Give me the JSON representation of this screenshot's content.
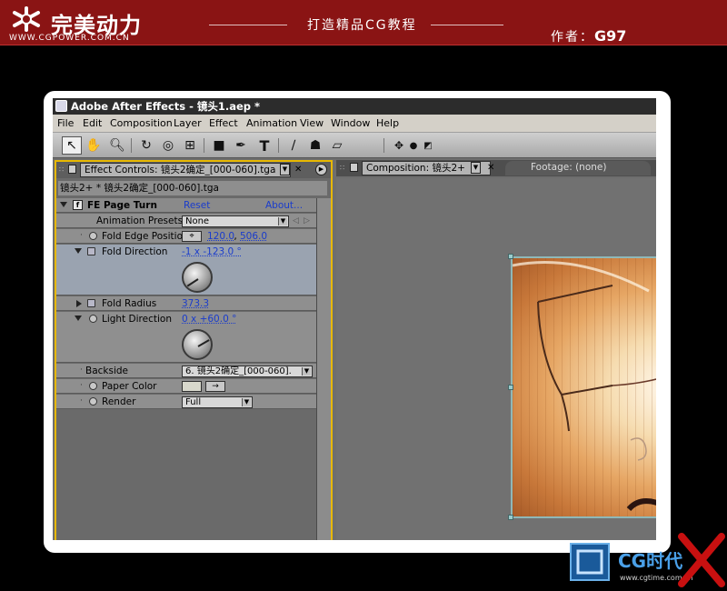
{
  "banner": {
    "logo_text": "完美动力",
    "logo_url": "WWW.CGPOWER.COM.CN",
    "tagline": "打造精品CG教程",
    "author_label": "作者：",
    "author_name": "G97"
  },
  "window": {
    "title": "Adobe After Effects - 镜头1.aep *"
  },
  "menu": [
    "File",
    "Edit",
    "Composition",
    "Layer",
    "Effect",
    "Animation",
    "View",
    "Window",
    "Help"
  ],
  "effect_controls": {
    "tab_label": "Effect Controls: 镜头2确定_[000-060].tga",
    "path": "镜头2+ * 镜头2确定_[000-060].tga",
    "effect_name": "FE Page Turn",
    "reset_label": "Reset",
    "about_label": "About...",
    "presets_label": "Animation Presets:",
    "presets_value": "None",
    "properties": {
      "fold_edge_position": {
        "label": "Fold Edge Positio",
        "x": "120.0",
        "y": "506.0",
        "sep": " , "
      },
      "fold_direction": {
        "label": "Fold Direction",
        "value": "-1 x -123.0 °"
      },
      "fold_radius": {
        "label": "Fold Radius",
        "value": "373.3"
      },
      "light_direction": {
        "label": "Light Direction",
        "value": "0 x +60.0 °"
      },
      "backside": {
        "label": "Backside",
        "value": "6. 镜头2确定_[000-060]."
      },
      "paper_color": {
        "label": "Paper Color"
      },
      "render": {
        "label": "Render",
        "value": "Full"
      }
    }
  },
  "composition": {
    "tab_label": "Composition: 镜头2+",
    "footage_label": "Footage: (none)"
  }
}
